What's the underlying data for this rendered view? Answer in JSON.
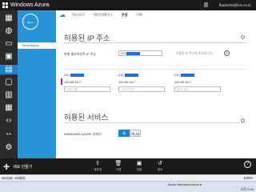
{
  "topbar": {
    "title": "Windows Azure",
    "chevron": "⌄",
    "account": "fbador05@live.co.kr"
  },
  "rail": {
    "icons": [
      "grid-icon",
      "globe-icon",
      "database-icon",
      "server-icon",
      "stack-icon",
      "box-icon",
      "storage-icon",
      "table-icon",
      "code-icon",
      "gear-icon"
    ]
  },
  "nav": {
    "back_glyph": "←",
    "selected_item": "behindapps"
  },
  "tabs": [
    "대시보드",
    "데이터베이스",
    "구성",
    "기록"
  ],
  "section1": {
    "title": "허용된 IP 주소",
    "help": "?",
    "current_ip_label": "현재 클라이언트 IP 주소",
    "current_ip_value": "210",
    "add_hint": "허용된 IP 주소에 추가합니다.",
    "add_glyph": "+",
    "columns": [
      {
        "start": "210",
        "end": "100.80.53.7",
        "placeholder": "규칙 이름"
      },
      {
        "start": "210",
        "end": "100.80.53.7",
        "placeholder": "시작 IP 주소"
      },
      {
        "start": "210",
        "end": "100.80.52.7",
        "placeholder": "끝 IP 주소"
      }
    ]
  },
  "section2": {
    "title": "허용된 서비스",
    "help": "?",
    "service_label": "WINDOWS AZURE 서비스",
    "toggle_on": "예",
    "toggle_off": "아니요"
  },
  "cmdbar": {
    "new_label": "새로 만들기",
    "commands": [
      {
        "icon": "export-icon",
        "label": "내보내"
      },
      {
        "icon": "delete-icon",
        "label": "삭제"
      },
      {
        "icon": "save-icon",
        "label": "저장"
      },
      {
        "icon": "undo-icon",
        "label": "취소"
      }
    ],
    "help": "?"
  },
  "statusbar": {
    "left": "ascript: void(0)",
    "zoom": "100%"
  },
  "taskbar": {
    "items": "Azure   Windows Azure   ▸",
    "clock": "오전 9:30"
  },
  "colors": {
    "accent": "#2893d6",
    "redaction": "#1e6fd9",
    "marker": "#9b2fae"
  }
}
